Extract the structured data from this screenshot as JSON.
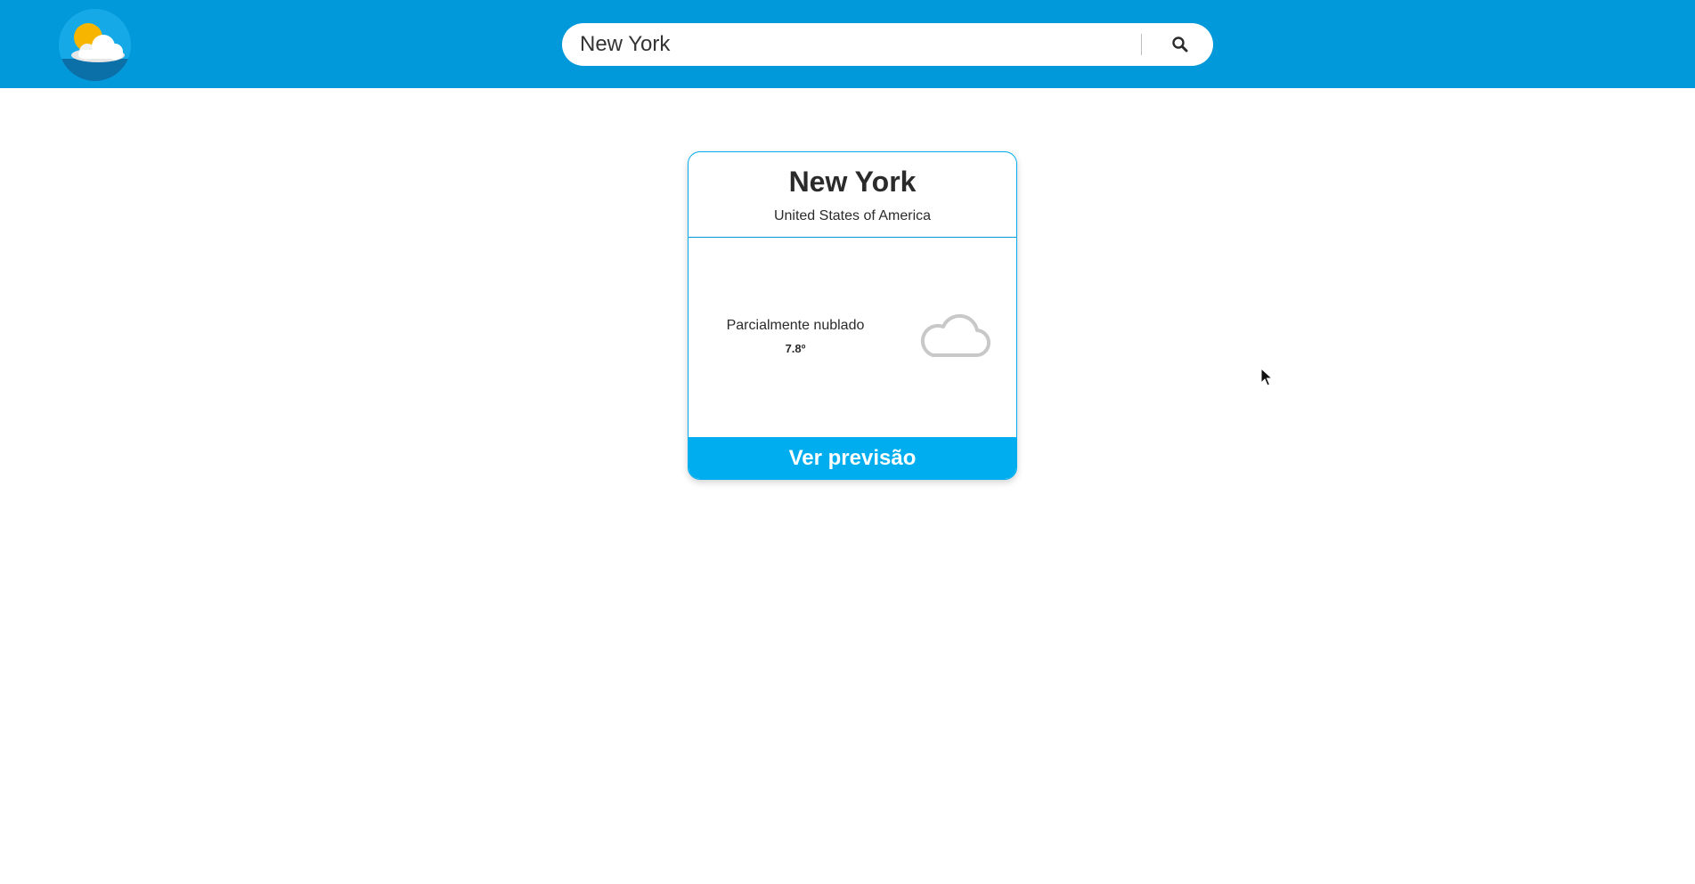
{
  "header": {
    "logo_icon": "sun-behind-cloud-icon",
    "search": {
      "value": "New York",
      "button_icon": "search-icon"
    },
    "bar_color": "#0299db"
  },
  "card": {
    "city": "New York",
    "country": "United States of America",
    "condition": "Parcialmente nublado",
    "temperature": "7.8º",
    "weather_icon": "partly-cloudy-night-icon",
    "forecast_button_label": "Ver previsão",
    "accent_color": "#00aeef"
  }
}
